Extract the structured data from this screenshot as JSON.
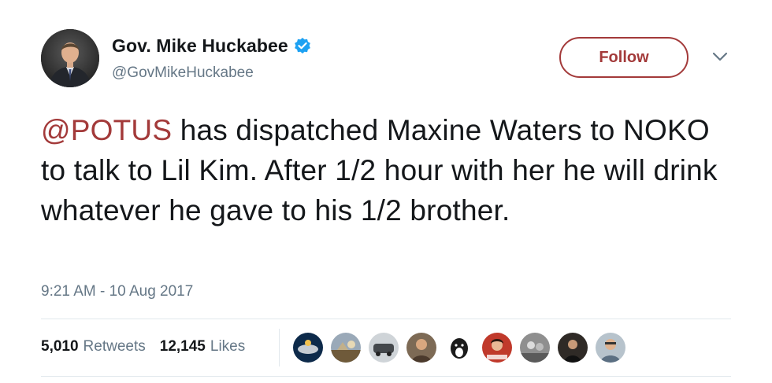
{
  "user": {
    "display_name": "Gov. Mike Huckabee",
    "handle": "@GovMikeHuckabee",
    "verified": true
  },
  "actions": {
    "follow_label": "Follow"
  },
  "tweet": {
    "mention": "@POTUS",
    "text": " has dispatched Maxine Waters to NOKO to talk to Lil Kim. After 1/2 hour with her he will drink whatever he gave to his 1/2 brother.",
    "timestamp": "9:21 AM - 10 Aug 2017"
  },
  "stats": {
    "retweets_count": "5,010",
    "retweets_label": "Retweets",
    "likes_count": "12,145",
    "likes_label": "Likes"
  },
  "colors": {
    "accent": "#a33a3a",
    "verified_blue": "#1da1f2",
    "secondary_text": "#657786",
    "divider": "#e1e8ed"
  },
  "icons": [
    "verified-icon",
    "chevron-down-icon"
  ],
  "liker_avatars_count": 9
}
